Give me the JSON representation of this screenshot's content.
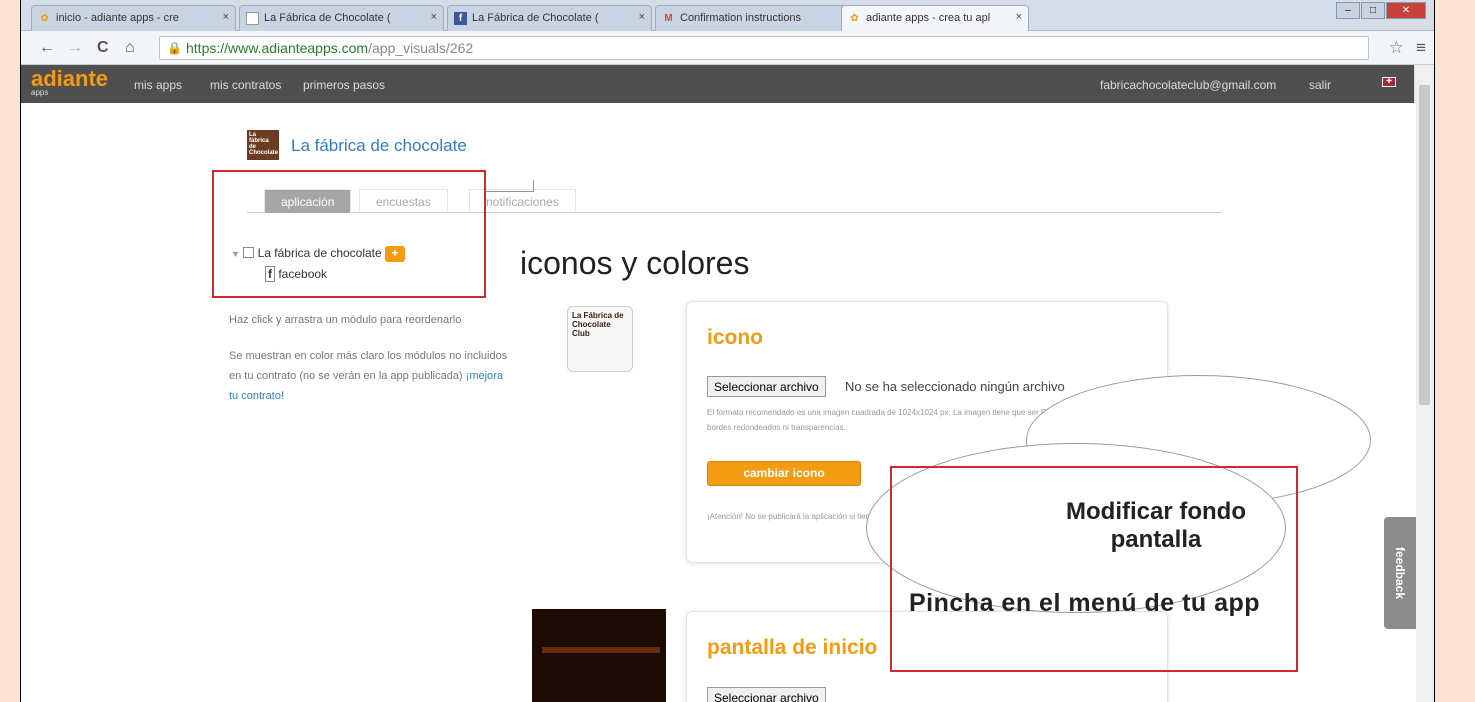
{
  "browser": {
    "tabs": [
      {
        "label": "inicio - adiante apps - cre",
        "favicon": "adiante-favicon"
      },
      {
        "label": "La Fábrica de Chocolate (",
        "favicon": "page-favicon"
      },
      {
        "label": "La Fábrica de Chocolate (",
        "favicon": "facebook-favicon"
      },
      {
        "label": "Confirmation instructions",
        "favicon": "gmail-favicon"
      },
      {
        "label": "adiante apps - crea tu apl",
        "favicon": "adiante-favicon"
      }
    ],
    "tab_close": "×",
    "url_host": "https://www.adianteapps.com",
    "url_path": "/app_visuals/262"
  },
  "app_header": {
    "logo": "adiante",
    "logo_sub": "apps",
    "nav": [
      "mis apps",
      "mis contratos",
      "primeros pasos"
    ],
    "email": "fabricachocolateclub@gmail.com",
    "logout": "salir"
  },
  "page": {
    "app_name": "La fábrica de chocolate",
    "app_icon_text": "La fábrica de Chocolate",
    "tabs": [
      "aplicación",
      "encuestas",
      "notificaciones"
    ],
    "tree_root": "La fábrica de chocolate",
    "tree_plus": "+",
    "tree_child": "facebook",
    "hint_1": "Haz click y arrastra un módulo para reordenarlo",
    "hint_2": "Se muestran en color más claro los módulos no incluidos en tu contrato (no se verán en la app publicada)",
    "hint_link": "¡mejora tu contrato!",
    "section_title": "iconos y colores",
    "icon_card": {
      "thumb_text": "La Fábrica de Chocolate Club",
      "title": "icono",
      "file_button": "Seleccionar archivo",
      "file_status": "No se ha seleccionado ningún archivo",
      "format_note": "El formato recomendado es una imagen cuadrada de 1024x1024 px. La imagen tiene que ser PNG o JPG, y no puede tener bordes redondeados ni transparencias.",
      "action": "cambiar icono",
      "warning": "¡Atención! No se publicará la aplicación si tiene el icono"
    },
    "splash_card": {
      "title": "pantalla de inicio",
      "file_button": "Seleccionar archivo"
    },
    "feedback": "feedback"
  },
  "overlay": {
    "cloud_title": "Modificar fondo pantalla",
    "cloud_body": "Pincha en el menú de tu app"
  },
  "colors": {
    "accent_orange": "#f39c12",
    "link_blue": "#2e7fbf",
    "highlight_red": "#d0282c"
  }
}
